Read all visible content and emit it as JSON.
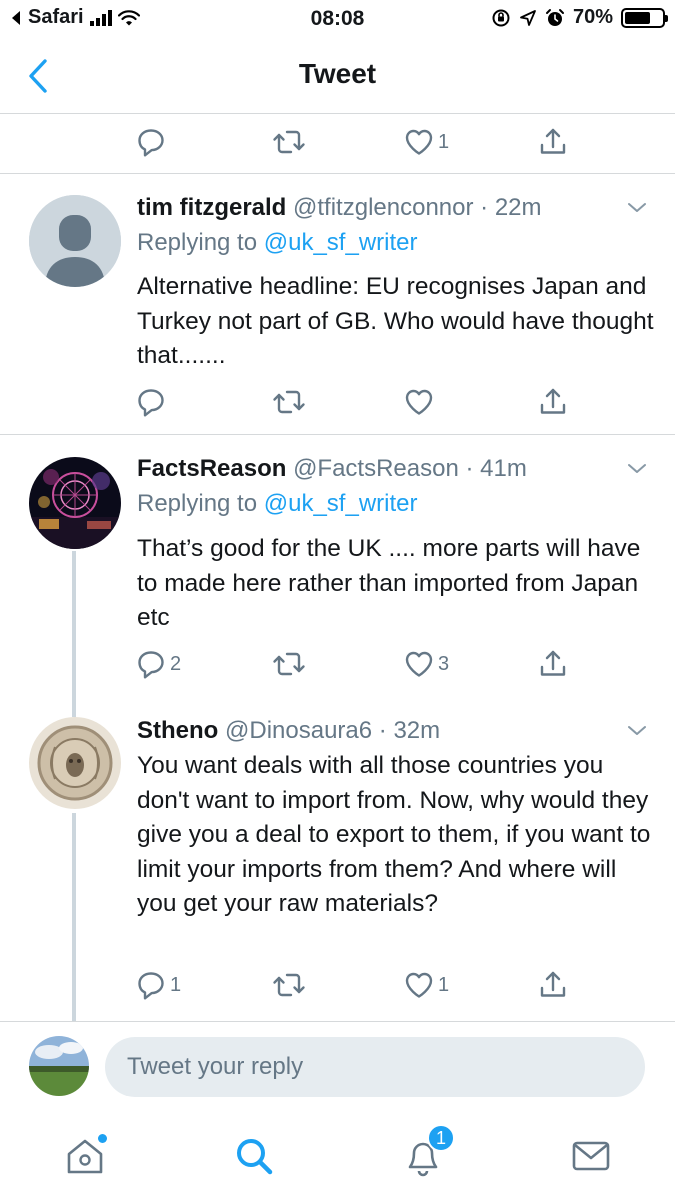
{
  "status_bar": {
    "carrier": "Safari",
    "time": "08:08",
    "battery_percent": "70%",
    "battery_level": 0.7
  },
  "nav": {
    "title": "Tweet"
  },
  "top_actions": {
    "likes": "1"
  },
  "tweets": [
    {
      "name": "tim fitzgerald",
      "handle": "@tfitzglenconnor",
      "time": "· 22m",
      "replying_label": "Replying to",
      "replying_to": "@uk_sf_writer",
      "text": "Alternative headline: EU recognises Japan and Turkey not part of GB. Who would have thought that.......",
      "replies": "",
      "likes": ""
    },
    {
      "name": "FactsReason",
      "handle": "@FactsReason",
      "time": "· 41m",
      "replying_label": "Replying to",
      "replying_to": "@uk_sf_writer",
      "text": "That’s good for the UK .... more parts will have to made here rather than imported from Japan etc",
      "replies": "2",
      "likes": "3"
    },
    {
      "name": "Stheno",
      "handle": "@Dinosaura6",
      "time": "· 32m",
      "text": "You want deals with all those countries you don't want to import from. Now, why would they give you a deal to export to them, if you want to limit your imports from them? And where will you get your raw materials?",
      "replies": "1",
      "likes": "1"
    }
  ],
  "composer": {
    "placeholder": "Tweet your reply"
  },
  "tab_bar": {
    "notifications_count": "1"
  },
  "colors": {
    "accent": "#1da1f2",
    "secondary_text": "#657786",
    "divider": "#d6d9db"
  },
  "icons": [
    "back-chevron-icon",
    "reply-icon",
    "retweet-icon",
    "like-icon",
    "share-icon",
    "caret-down-icon",
    "home-icon",
    "search-icon",
    "notifications-icon",
    "messages-icon"
  ]
}
